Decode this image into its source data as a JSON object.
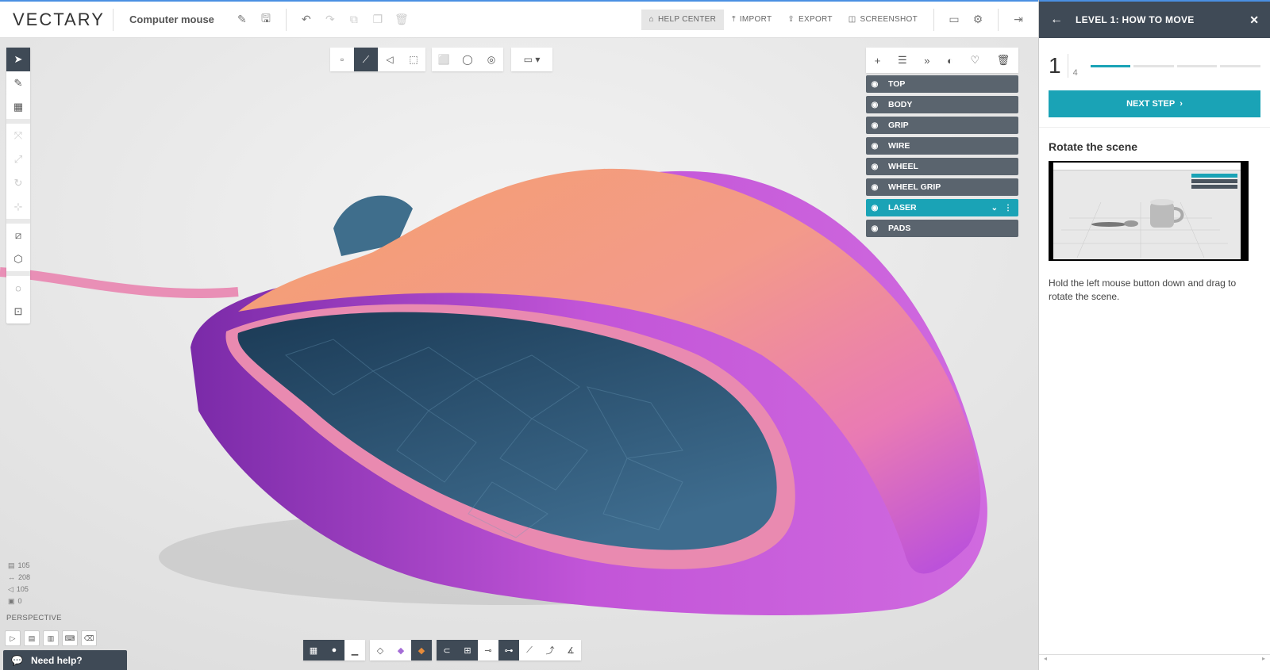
{
  "app": {
    "logo": "VECTARY",
    "project_name": "Computer mouse"
  },
  "toolbar": {
    "help_center": "HELP CENTER",
    "import": "IMPORT",
    "export": "EXPORT",
    "screenshot": "SCREENSHOT",
    "icons": [
      "pencil-icon",
      "save-icon",
      "undo-icon",
      "redo-icon",
      "copy-icon",
      "duplicate-icon",
      "delete-icon",
      "monitor-icon",
      "settings-icon",
      "exit-icon"
    ]
  },
  "tutorial": {
    "title": "LEVEL 1: HOW TO MOVE",
    "current_step": "1",
    "total_steps": "4",
    "progress_fraction": 0.25,
    "next_button": "NEXT STEP",
    "lesson_title": "Rotate the scene",
    "lesson_text": "Hold the left mouse button down and drag to rotate the scene."
  },
  "layers": [
    {
      "name": "TOP",
      "selected": false
    },
    {
      "name": "BODY",
      "selected": false
    },
    {
      "name": "GRIP",
      "selected": false
    },
    {
      "name": "WIRE",
      "selected": false
    },
    {
      "name": "WHEEL",
      "selected": false
    },
    {
      "name": "WHEEL GRIP",
      "selected": false
    },
    {
      "name": "LASER",
      "selected": true
    },
    {
      "name": "PADS",
      "selected": false
    }
  ],
  "stats": {
    "faces": "105",
    "edges": "208",
    "vertices": "105",
    "objects": "0"
  },
  "view_mode": "PERSPECTIVE",
  "help": {
    "label": "Need help?"
  },
  "colors": {
    "accent": "#1aa3b6",
    "dark": "#3f4a56",
    "layer": "#5a646e"
  }
}
